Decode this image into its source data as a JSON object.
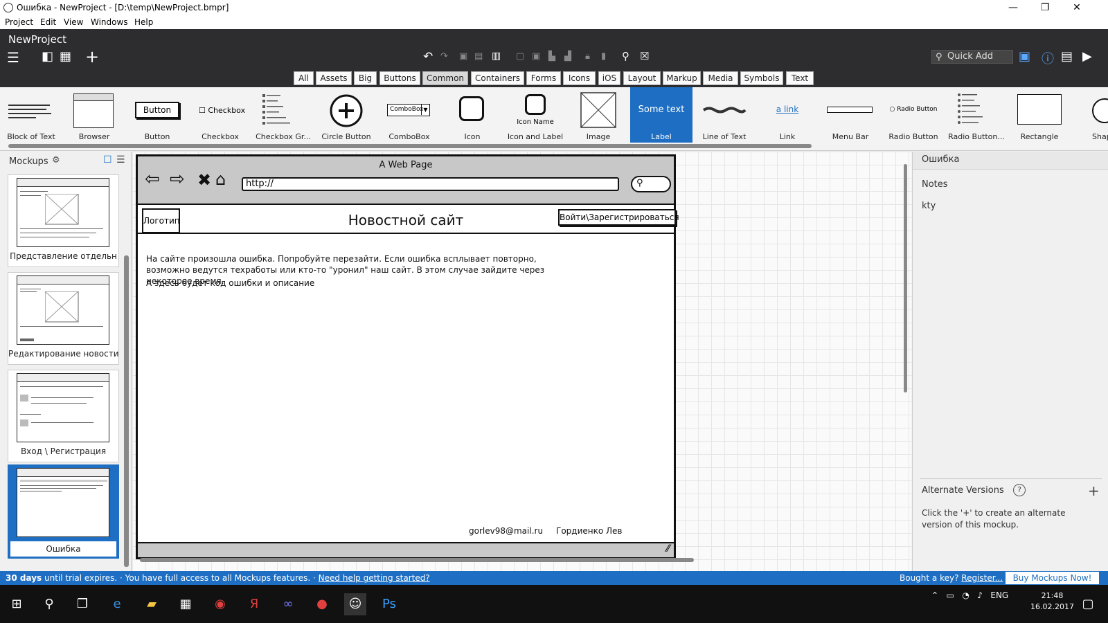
{
  "window": {
    "title": "Ошибка - NewProject - [D:\\temp\\NewProject.bmpr]",
    "minimize": "—",
    "restore": "❐",
    "close": "✕"
  },
  "menu": [
    "Project",
    "Edit",
    "View",
    "Windows",
    "Help"
  ],
  "toolbar": {
    "project_name": "NewProject",
    "quick_add_placeholder": "Quick Add"
  },
  "categories": [
    {
      "label": "All"
    },
    {
      "label": "Assets"
    },
    {
      "label": "Big"
    },
    {
      "label": "Buttons"
    },
    {
      "label": "Common",
      "selected": true
    },
    {
      "label": "Containers"
    },
    {
      "label": "Forms"
    },
    {
      "label": "Icons"
    },
    {
      "label": "iOS"
    },
    {
      "label": "Layout"
    },
    {
      "label": "Markup"
    },
    {
      "label": "Media"
    },
    {
      "label": "Symbols"
    },
    {
      "label": "Text"
    }
  ],
  "components": [
    {
      "label": "Block of Text"
    },
    {
      "label": "Browser"
    },
    {
      "label": "Button",
      "preview": "Button"
    },
    {
      "label": "Checkbox",
      "preview": "Checkbox"
    },
    {
      "label": "Checkbox Gr..."
    },
    {
      "label": "Circle Button"
    },
    {
      "label": "ComboBox",
      "preview": "ComboBox"
    },
    {
      "label": "Icon"
    },
    {
      "label": "Icon and Label",
      "preview": "Icon Name"
    },
    {
      "label": "Image"
    },
    {
      "label": "Label",
      "preview": "Some text",
      "selected": true
    },
    {
      "label": "Line of Text"
    },
    {
      "label": "Link",
      "preview": "a link"
    },
    {
      "label": "Menu Bar"
    },
    {
      "label": "Radio Button",
      "preview": "Radio Button"
    },
    {
      "label": "Radio Button..."
    },
    {
      "label": "Rectangle"
    },
    {
      "label": "Shap"
    }
  ],
  "mockups_panel": {
    "title": "Mockups",
    "items": [
      {
        "label": "Представление отдельн"
      },
      {
        "label": "Редактирование новости"
      },
      {
        "label": "Вход \\ Регистрация"
      },
      {
        "label": "Ошибка",
        "selected": true
      }
    ]
  },
  "mockup": {
    "browser_title": "A Web Page",
    "url": "http://",
    "logo": "Логотип",
    "site_title": "Новостной сайт",
    "login_button": "Войти\\Зарегистрироваться",
    "error_text": "На сайте произошла ошибка. Попробуйте перезайти. Если ошибка всплывает повторно, возможно ведутся техработы или кто-то \"уронил\" наш сайт. В этом случае зайдите через некоторое время.",
    "error_code_text": "А здесь будет код ошибки и описание",
    "email": "gorlev98@mail.ru",
    "author": "Гордиенко Лев"
  },
  "properties_panel": {
    "title": "Ошибка",
    "notes_label": "Notes",
    "notes_value": "kty",
    "alt_versions_label": "Alternate Versions",
    "alt_help": "Click the '+' to create an alternate version of this mockup."
  },
  "trial": {
    "days": "30 days",
    "text": " until trial expires. · You have full access to all Mockups features. · ",
    "help_link": "Need help getting started?",
    "bought": "Bought a key? ",
    "register_link": "Register...",
    "buy_button": "Buy Mockups Now!"
  },
  "taskbar": {
    "lang": "ENG",
    "time": "21:48",
    "date": "16.02.2017"
  }
}
